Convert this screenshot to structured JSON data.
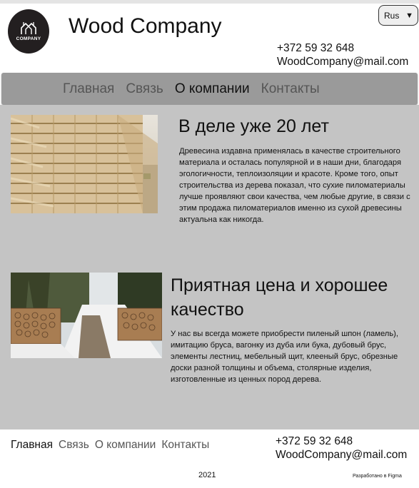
{
  "header": {
    "logo_text": "COMPANY",
    "title": "Wood Company",
    "language": "Rus",
    "language_chevron": "▼",
    "phone": "+372 59 32 648",
    "email": "WoodCompany@mail.com"
  },
  "nav": {
    "items": [
      {
        "label": "Главная"
      },
      {
        "label": "Связь"
      },
      {
        "label": "О компании"
      },
      {
        "label": "Контакты"
      }
    ],
    "active": "О компании"
  },
  "sections": [
    {
      "heading": "В деле уже 20 лет",
      "text": "Древесина издавна применялась в качестве строительного материала и осталась популярной и в наши дни, благодаря эгологичности, теплоизоляции и красоте. Кроме того, опыт строительства из дерева показал, что сухие пиломатериалы лучше проявляют свои качества, чем любые другие, в связи с этим продажа пиломатериалов именно из сухой древесины актуальна как никогда.",
      "image": "stacked-lumber-photo"
    },
    {
      "heading": "Приятная цена и хорошее качество",
      "text": "У нас вы всегда можете приобрести пиленый шпон (ламель), имитацию бруса, вагонку из дуба или бука, дубовый брус, элементы лестниц, мебельный щит, клееный брус, обрезные доски разной толщины и объема, столярные изделия, изготовленные из ценных пород дерева.",
      "image": "forest-log-piles-photo"
    }
  ],
  "footer": {
    "nav": [
      {
        "label": "Главная"
      },
      {
        "label": "Связь"
      },
      {
        "label": "О компании"
      },
      {
        "label": "Контакты"
      }
    ],
    "phone": "+372 59 32 648",
    "email": "WoodCompany@mail.com",
    "year": "2021",
    "made_with": "Разработано в Figma"
  },
  "colors": {
    "nav_bg": "#9a9a9a",
    "main_bg": "#c4c4c4",
    "logo_bg": "#231f20",
    "inactive_link": "#555555"
  }
}
